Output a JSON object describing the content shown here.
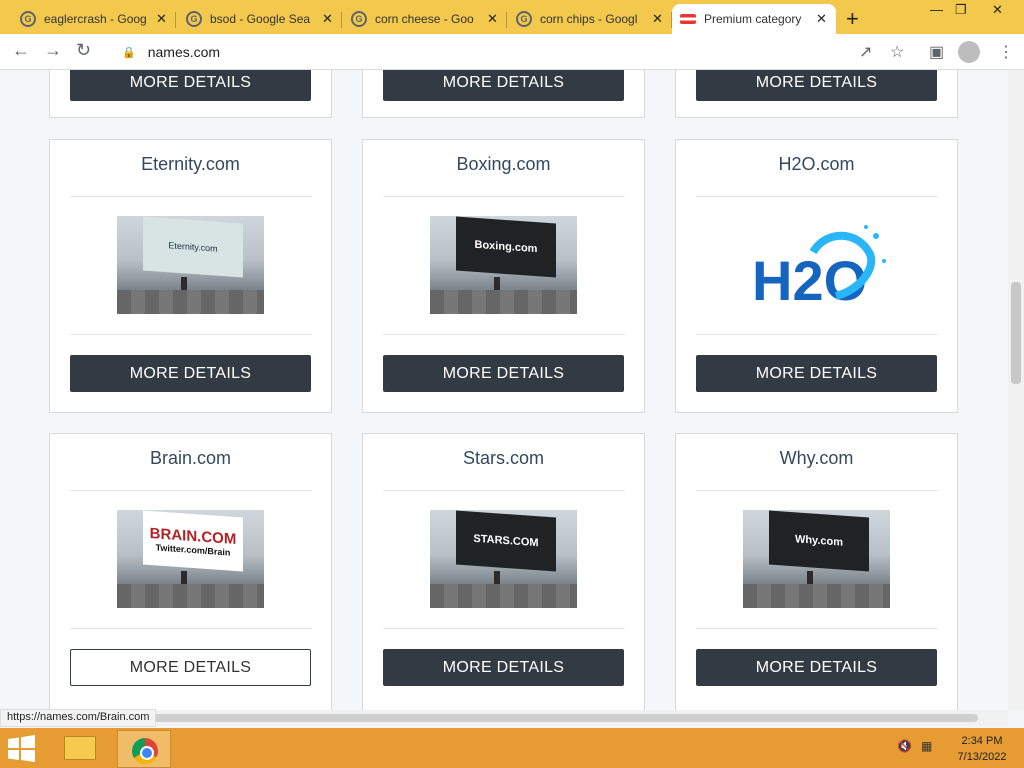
{
  "browser": {
    "tabs": [
      {
        "title": "eaglercrash - Goog",
        "icon": "google-g-icon"
      },
      {
        "title": "bsod - Google Sea",
        "icon": "google-g-icon"
      },
      {
        "title": "corn cheese - Goo",
        "icon": "google-g-icon"
      },
      {
        "title": "corn chips - Googl",
        "icon": "google-g-icon"
      },
      {
        "title": "Premium category",
        "icon": "names-com-icon",
        "active": true
      }
    ],
    "new_tab_icon": "plus-icon",
    "url": "names.com",
    "status_url": "https://names.com/Brain.com"
  },
  "domains": {
    "rows": [
      {
        "cards": [
          {
            "button": "MORE DETAILS"
          },
          {
            "button": "MORE DETAILS"
          },
          {
            "button": "MORE DETAILS"
          }
        ]
      },
      {
        "cards": [
          {
            "name": "Eternity.com",
            "billboard": "Eternity.com",
            "button": "MORE DETAILS"
          },
          {
            "name": "Boxing.com",
            "billboard": "Boxing.com",
            "button": "MORE DETAILS"
          },
          {
            "name": "H2O.com",
            "billboard": "H2O",
            "button": "MORE DETAILS"
          }
        ]
      },
      {
        "cards": [
          {
            "name": "Brain.com",
            "billboard": "BRAIN.COM",
            "billboard_sub": "Twitter.com/Brain",
            "button": "MORE DETAILS"
          },
          {
            "name": "Stars.com",
            "billboard": "STARS.COM",
            "button": "MORE DETAILS"
          },
          {
            "name": "Why.com",
            "billboard": "Why.com",
            "button": "MORE DETAILS"
          }
        ]
      }
    ]
  },
  "taskbar": {
    "time": "2:34 PM",
    "date": "7/13/2022"
  },
  "colors": {
    "tabstrip": "#f2c94c",
    "button": "#323a43",
    "domain_title": "#34495e",
    "taskbar": "#e69c32"
  }
}
